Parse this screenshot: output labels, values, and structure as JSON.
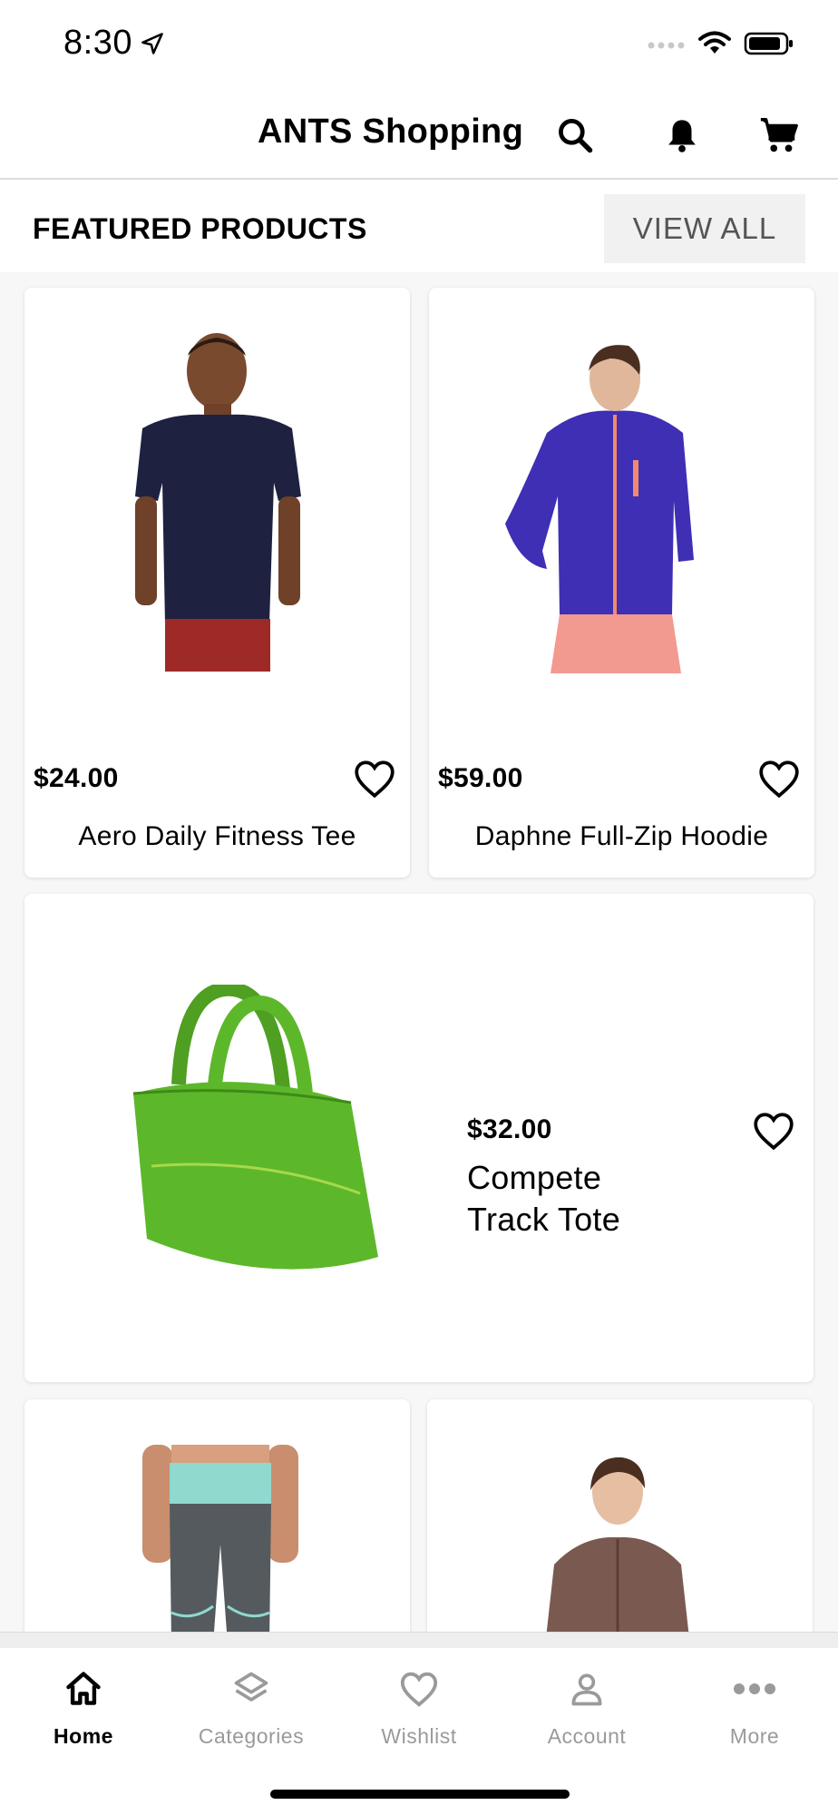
{
  "status": {
    "time": "8:30"
  },
  "header": {
    "title": "ANTS Shopping"
  },
  "section": {
    "title": "FEATURED PRODUCTS",
    "view_all": "VIEW ALL"
  },
  "products": [
    {
      "price": "$24.00",
      "name": "Aero Daily Fitness Tee"
    },
    {
      "price": "$59.00",
      "name": "Daphne Full-Zip Hoodie"
    },
    {
      "price": "$32.00",
      "name_line1": "Compete",
      "name_line2": "Track Tote"
    }
  ],
  "tabs": [
    {
      "label": "Home",
      "icon": "home-icon",
      "active": true
    },
    {
      "label": "Categories",
      "icon": "layers-icon",
      "active": false
    },
    {
      "label": "Wishlist",
      "icon": "heart-icon",
      "active": false
    },
    {
      "label": "Account",
      "icon": "person-icon",
      "active": false
    },
    {
      "label": "More",
      "icon": "more-dots-icon",
      "active": false
    }
  ],
  "colors": {
    "active_tab": "#000000",
    "inactive_tab": "#9a9a9a",
    "tee": "#1e2240",
    "hoodie": "#3e2fb4",
    "tote": "#5cb82a",
    "view_all_bg": "#f1f1f1"
  }
}
